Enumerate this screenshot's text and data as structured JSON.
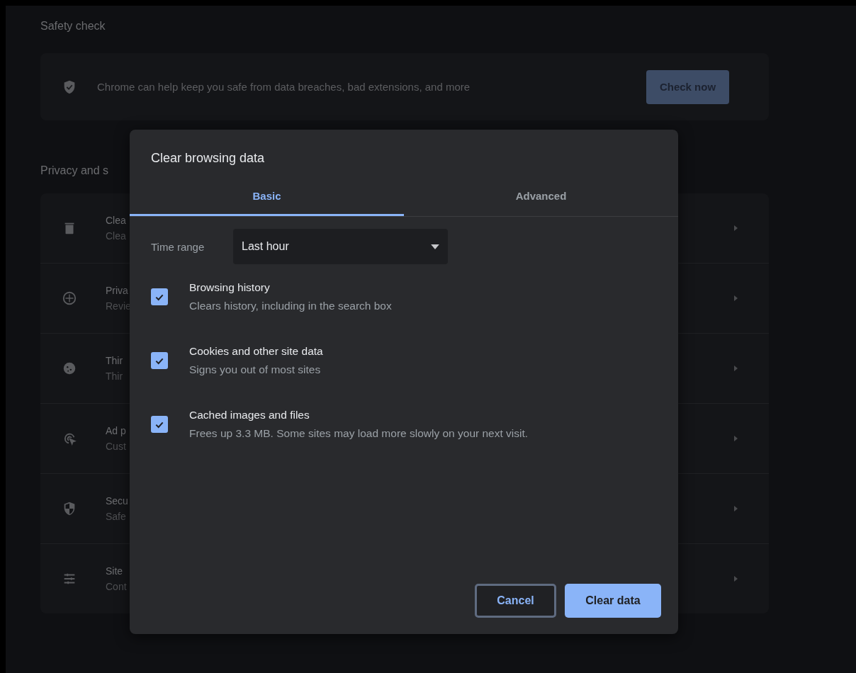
{
  "safety_check": {
    "heading": "Safety check",
    "description": "Chrome can help keep you safe from data breaches, bad extensions, and more",
    "button": "Check now"
  },
  "privacy": {
    "heading": "Privacy and s",
    "rows": [
      {
        "title": "Clea",
        "subtitle": "Clea"
      },
      {
        "title": "Priva",
        "subtitle": "Revie"
      },
      {
        "title": "Thir",
        "subtitle": "Thir"
      },
      {
        "title": "Ad p",
        "subtitle": "Cust"
      },
      {
        "title": "Secu",
        "subtitle": "Safe"
      },
      {
        "title": "Site",
        "subtitle": "Cont"
      }
    ]
  },
  "dialog": {
    "title": "Clear browsing data",
    "tabs": [
      {
        "label": "Basic",
        "selected": true
      },
      {
        "label": "Advanced",
        "selected": false
      }
    ],
    "time_range": {
      "label": "Time range",
      "value": "Last hour"
    },
    "options": [
      {
        "title": "Browsing history",
        "description": "Clears history, including in the search box",
        "checked": true
      },
      {
        "title": "Cookies and other site data",
        "description": "Signs you out of most sites",
        "checked": true
      },
      {
        "title": "Cached images and files",
        "description": "Frees up 3.3 MB. Some sites may load more slowly on your next visit.",
        "checked": true
      }
    ],
    "buttons": [
      {
        "label": "Cancel",
        "kind": "secondary"
      },
      {
        "label": "Clear data",
        "kind": "primary"
      }
    ]
  }
}
